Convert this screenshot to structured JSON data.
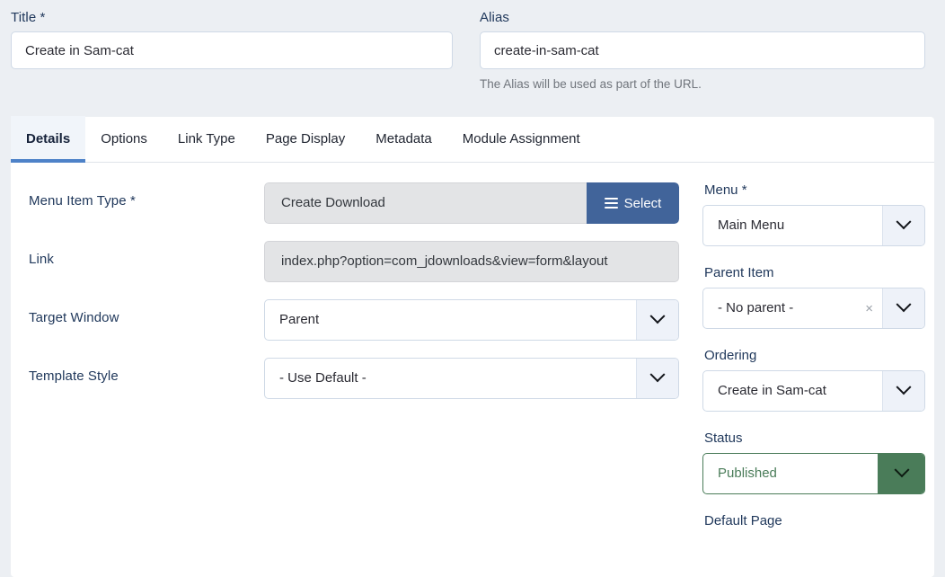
{
  "top_form": {
    "title": {
      "label": "Title *",
      "value": "Create in Sam-cat",
      "placeholder": "Title"
    },
    "alias": {
      "label": "Alias",
      "value": "create-in-sam-cat",
      "placeholder": "Alias",
      "help": "The Alias will be used as part of the URL."
    }
  },
  "tabs": [
    {
      "label": "Details",
      "active": true
    },
    {
      "label": "Options",
      "active": false
    },
    {
      "label": "Link Type",
      "active": false
    },
    {
      "label": "Page Display",
      "active": false
    },
    {
      "label": "Metadata",
      "active": false
    },
    {
      "label": "Module Assignment",
      "active": false
    }
  ],
  "details": {
    "menu_item_type": {
      "label": "Menu Item Type *",
      "value": "Create Download",
      "select_button": "Select",
      "select_icon": "list-icon"
    },
    "link": {
      "label": "Link",
      "value": "index.php?option=com_jdownloads&view=form&layout"
    },
    "target_window": {
      "label": "Target Window",
      "value": "Parent"
    },
    "template_style": {
      "label": "Template Style",
      "value": "- Use Default -"
    }
  },
  "sidebar": {
    "menu": {
      "label": "Menu *",
      "value": "Main Menu"
    },
    "parent_item": {
      "label": "Parent Item",
      "value": "- No parent -",
      "clear_glyph": "×"
    },
    "ordering": {
      "label": "Ordering",
      "value": "Create in Sam-cat"
    },
    "status": {
      "label": "Status",
      "value": "Published"
    },
    "default_page": {
      "label": "Default Page"
    }
  },
  "colors": {
    "page_background": "#eceff3",
    "panel_background": "#ffffff",
    "label_text": "#21395c",
    "active_tab_underline": "#4e82c8",
    "active_tab_background": "#f1f5fa",
    "select_button_blue": "#41649a",
    "status_green": "#4a7c59",
    "readonly_gray": "#e3e4e6",
    "input_border": "#cfd9e6",
    "dropdown_arrow_background": "#eef2f9",
    "help_text": "#70757c"
  }
}
